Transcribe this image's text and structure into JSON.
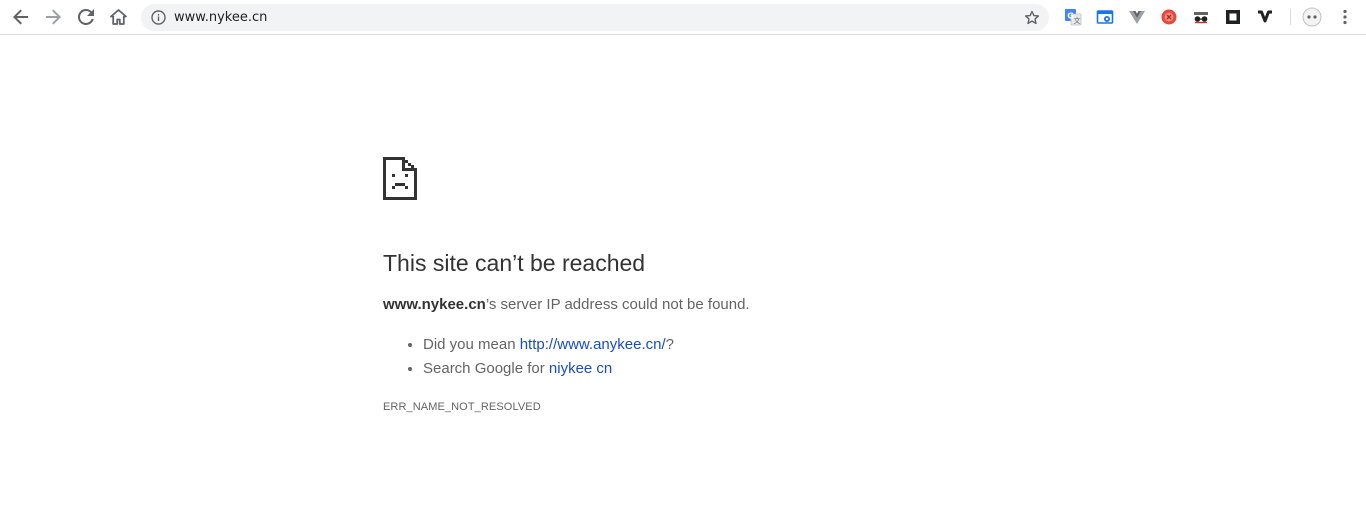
{
  "browser": {
    "url": "www.nykee.cn",
    "nav_icons": [
      "back-arrow-icon",
      "forward-arrow-icon",
      "reload-icon",
      "home-icon"
    ],
    "extension_icons": [
      "google-translate-icon",
      "screenshot-extension-icon",
      "vue-devtools-icon",
      "adblock-icon",
      "incognito-mask-icon",
      "square-extension-icon",
      "v-extension-icon"
    ],
    "accent_color": "#1a73e8"
  },
  "error_page": {
    "icon": "sad-page-icon",
    "headline": "This site can’t be reached",
    "summary_host": "www.nykee.cn",
    "summary_rest": "’s server IP address could not be found.",
    "suggestion_1_prefix": "Did you mean ",
    "suggestion_1_link": "http://www.anykee.cn/",
    "suggestion_1_suffix": "?",
    "suggestion_2_prefix": "Search Google for ",
    "suggestion_2_link": "niykee cn",
    "error_code": "ERR_NAME_NOT_RESOLVED",
    "link_color": "#1a4dc1",
    "text_color": "#646464",
    "heading_color": "#333333"
  }
}
